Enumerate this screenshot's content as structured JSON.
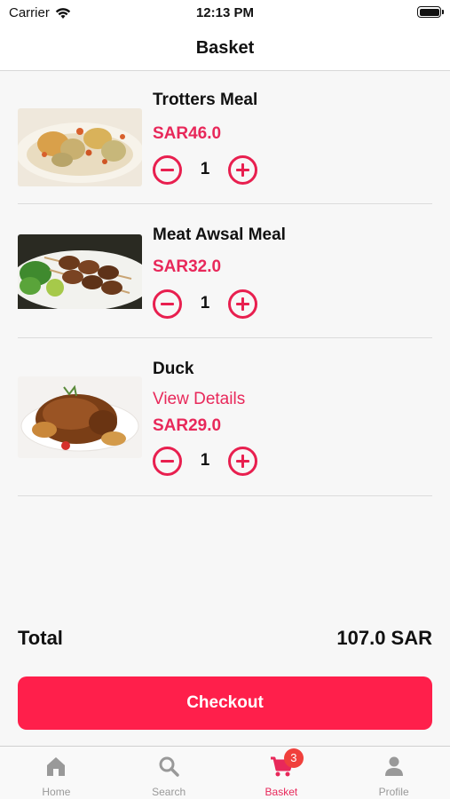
{
  "status_bar": {
    "carrier": "Carrier",
    "time": "12:13 PM"
  },
  "nav": {
    "title": "Basket"
  },
  "basket": {
    "items": [
      {
        "name": "Trotters Meal",
        "price": "SAR46.0",
        "quantity": "1",
        "image_icon": "trotters-meal-photo"
      },
      {
        "name": "Meat Awsal Meal",
        "price": "SAR32.0",
        "quantity": "1",
        "image_icon": "meat-skewers-photo"
      },
      {
        "name": "Duck",
        "details_link": "View Details",
        "price": "SAR29.0",
        "quantity": "1",
        "image_icon": "roast-duck-photo"
      }
    ]
  },
  "total": {
    "label": "Total",
    "value": "107.0 SAR"
  },
  "checkout": {
    "label": "Checkout"
  },
  "tabs": [
    {
      "label": "Home",
      "icon": "home-icon"
    },
    {
      "label": "Search",
      "icon": "search-icon"
    },
    {
      "label": "Basket",
      "icon": "cart-icon",
      "badge": "3",
      "active": true
    },
    {
      "label": "Profile",
      "icon": "profile-icon"
    }
  ],
  "colors": {
    "accent": "#e8285a",
    "button": "#ff1f4b",
    "badge": "#f0403c",
    "inactive_tab": "#999999"
  }
}
